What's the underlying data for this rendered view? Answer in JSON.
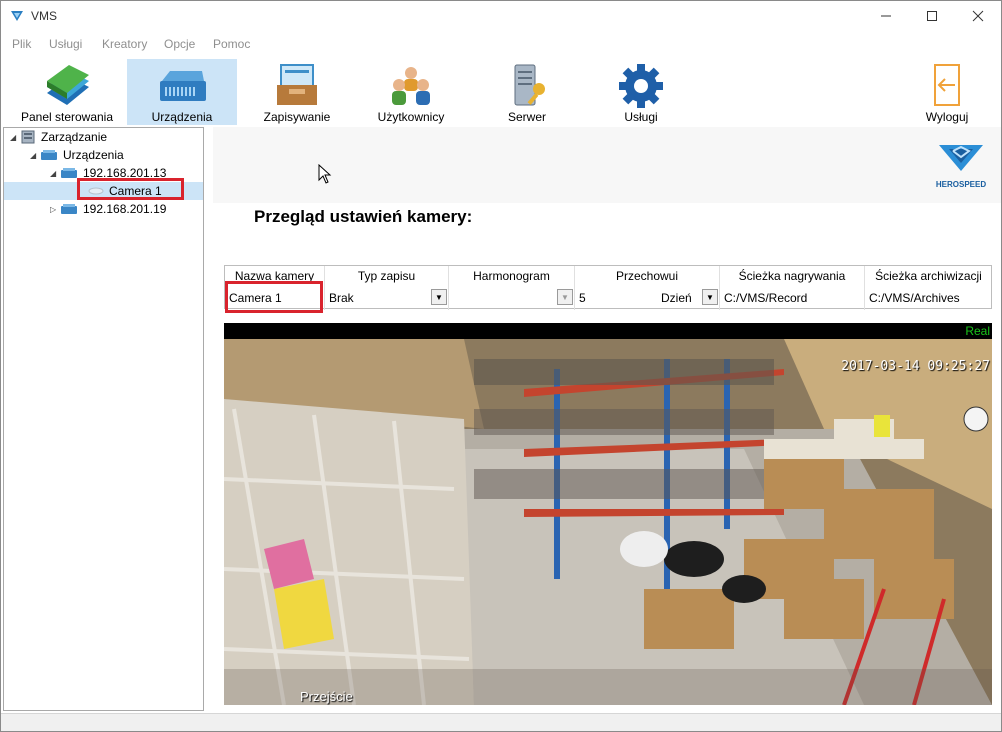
{
  "window": {
    "title": "VMS"
  },
  "menu": [
    "Plik",
    "Usługi",
    "Kreatory",
    "Opcje",
    "Pomoc"
  ],
  "toolbar": {
    "panel": "Panel sterowania",
    "devices": "Urządzenia",
    "recording": "Zapisywanie",
    "users": "Użytkownicy",
    "server": "Serwer",
    "services": "Usługi",
    "logout": "Wyloguj"
  },
  "tree": {
    "root": "Zarządzanie",
    "devices": "Urządzenia",
    "device1": "192.168.201.13",
    "camera1": "Camera 1",
    "device2": "192.168.201.19"
  },
  "logo_text": "HEROSPEED",
  "page_title": "Przegląd ustawień kamery:",
  "settings": {
    "headers": [
      "Nazwa kamery",
      "Typ zapisu",
      "Harmonogram",
      "Przechowui",
      "Ścieżka nagrywania",
      "Ścieżka archiwizacji"
    ],
    "camera_name": "Camera 1",
    "record_type": "Brak",
    "schedule": "",
    "retention_value": "5",
    "retention_unit": "Dzień",
    "record_path": "C:/VMS/Record",
    "archive_path": "C:/VMS/Archives"
  },
  "video": {
    "mode_label": "Real",
    "timestamp": "2017-03-14 09:25:27",
    "caption": "Przejście"
  },
  "colors": {
    "accent": "#cce4f7",
    "highlight": "#d9232d",
    "live": "#19c419"
  }
}
